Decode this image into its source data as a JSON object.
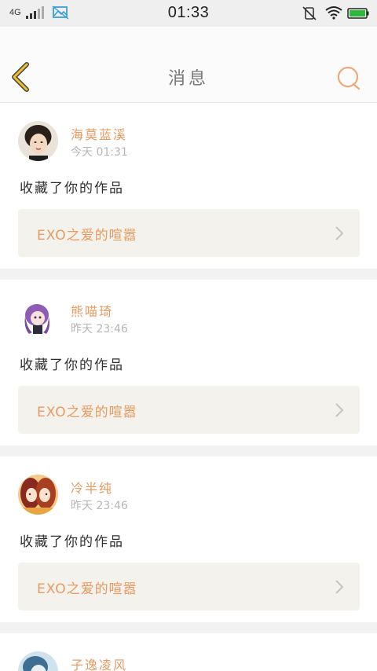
{
  "status_bar": {
    "network": "4G",
    "time": "01:33",
    "icons": [
      "signal-icon",
      "gallery-icon",
      "vibrate-off-icon",
      "wifi-icon",
      "battery-icon"
    ]
  },
  "header": {
    "title": "消息",
    "back_icon": "chevron-left-icon",
    "search_icon": "search-icon"
  },
  "colors": {
    "accent": "#e99a61",
    "back_yellow": "#f2c02e",
    "card_link_bg": "#f3f2ec"
  },
  "messages": [
    {
      "user": "海莫蓝溪",
      "time": "今天 01:31",
      "action": "收藏了你的作品",
      "work": "EXO之爱的喧嚣"
    },
    {
      "user": "熊喵琦",
      "time": "昨天 23:46",
      "action": "收藏了你的作品",
      "work": "EXO之爱的喧嚣"
    },
    {
      "user": "冷半纯",
      "time": "昨天 23:46",
      "action": "收藏了你的作品",
      "work": "EXO之爱的喧嚣"
    },
    {
      "user": "子逸凌风"
    }
  ]
}
